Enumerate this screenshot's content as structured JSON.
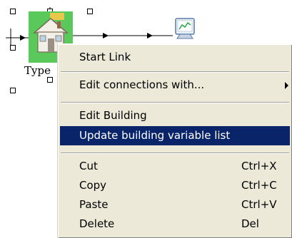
{
  "canvas": {
    "node_label": "Type",
    "house_icon": "house-icon",
    "monitor_icon": "monitor-chart-icon"
  },
  "context_menu": {
    "items": [
      {
        "label": "Start Link",
        "shortcut": "",
        "submenu": false,
        "highlighted": false
      },
      {
        "label": "Edit connections with...",
        "shortcut": "",
        "submenu": true,
        "highlighted": false
      },
      {
        "label": "Edit Building",
        "shortcut": "",
        "submenu": false,
        "highlighted": false
      },
      {
        "label": "Update building variable list",
        "shortcut": "",
        "submenu": false,
        "highlighted": true
      },
      {
        "label": "Cut",
        "shortcut": "Ctrl+X",
        "submenu": false,
        "highlighted": false
      },
      {
        "label": "Copy",
        "shortcut": "Ctrl+C",
        "submenu": false,
        "highlighted": false
      },
      {
        "label": "Paste",
        "shortcut": "Ctrl+V",
        "submenu": false,
        "highlighted": false
      },
      {
        "label": "Delete",
        "shortcut": "Del",
        "submenu": false,
        "highlighted": false
      }
    ]
  },
  "colors": {
    "menu_background": "#ece9d8",
    "highlight": "#0a246a",
    "node_fill": "#5ac85a"
  }
}
